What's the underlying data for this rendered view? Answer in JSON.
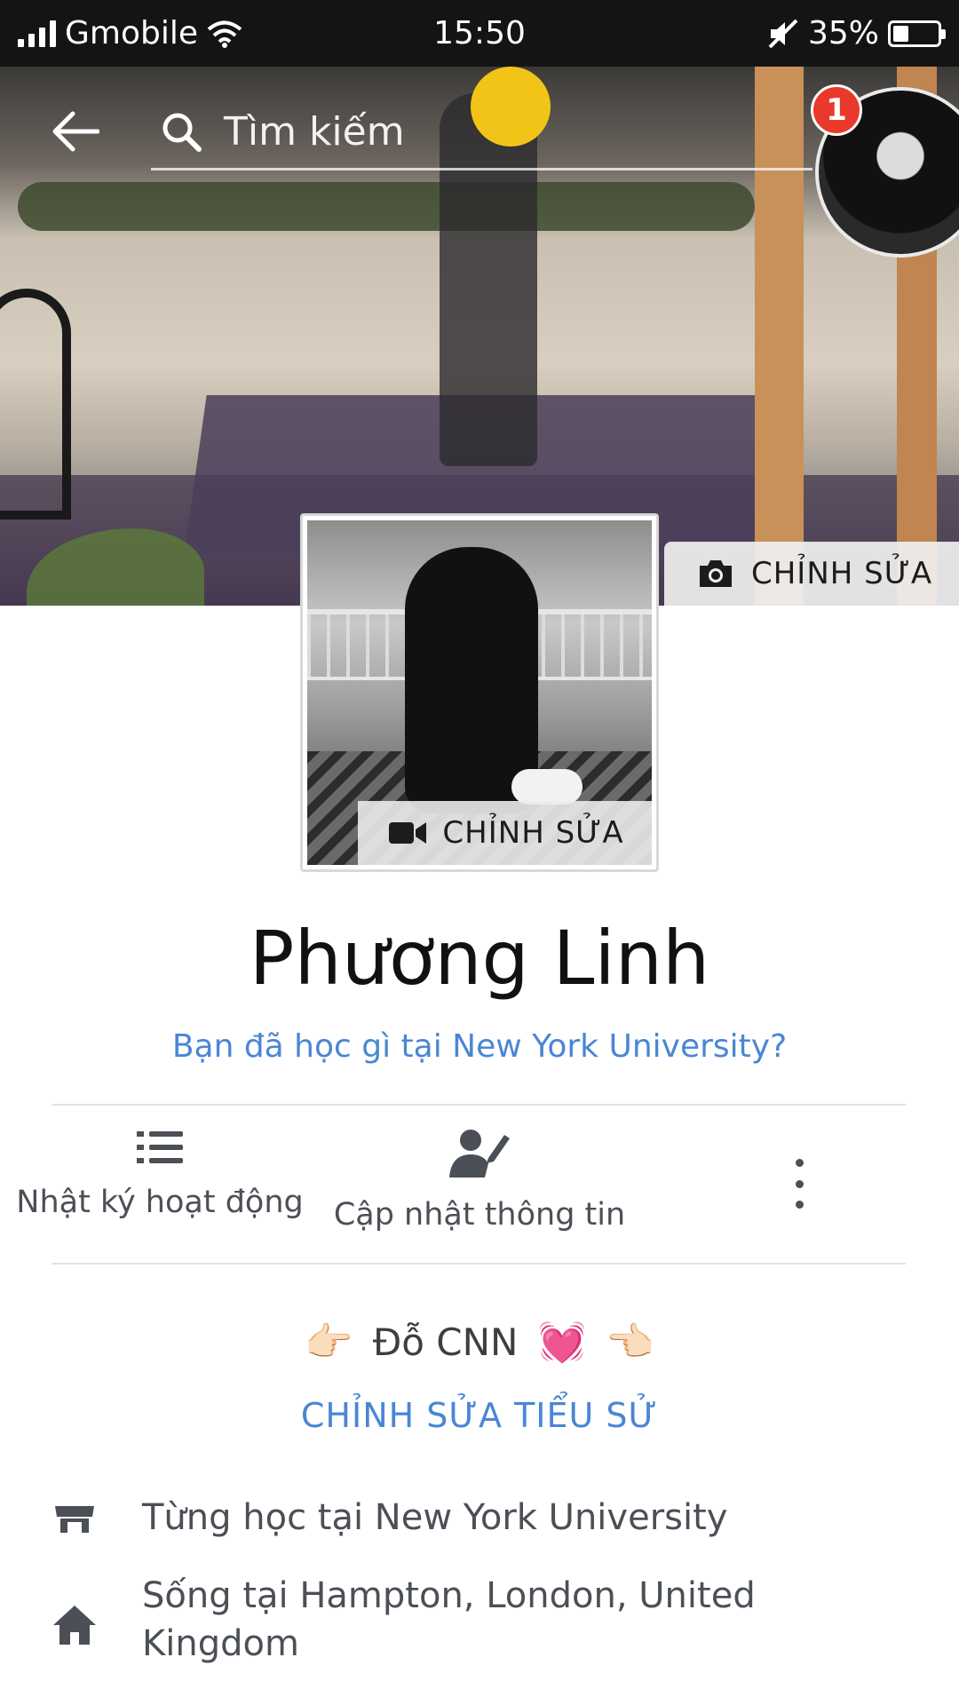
{
  "status_bar": {
    "carrier": "Gmobile",
    "time": "15:50",
    "battery_text": "35%",
    "battery_level": 0.35
  },
  "header": {
    "search_placeholder": "Tìm kiếm",
    "notification_count": "1"
  },
  "cover": {
    "edit_label": "CHỈNH SỬA"
  },
  "profile_picture": {
    "edit_label": "CHỈNH SỬA"
  },
  "profile": {
    "name": "Phương Linh",
    "prompt": "Bạn đã học gì tại New York University?"
  },
  "actions": [
    {
      "label": "Nhật ký hoạt động",
      "icon": "list-icon"
    },
    {
      "label": "Cập nhật thông tin",
      "icon": "edit-profile-icon"
    }
  ],
  "bio": {
    "text": "Đỗ CNN",
    "left_emoji": "👉🏻",
    "heart_emoji": "💓",
    "right_emoji": "👈🏻",
    "edit_label": "CHỈNH SỬA TIỂU SỬ"
  },
  "info": [
    {
      "icon": "education-icon",
      "text": "Từng học tại New York University"
    },
    {
      "icon": "home-icon",
      "text": "Sống tại Hampton, London, United Kingdom"
    }
  ],
  "colors": {
    "link_blue": "#4a86d4",
    "text_gray": "#4b4f56",
    "badge_red": "#e8392b",
    "status_bar_bg": "#141414"
  }
}
